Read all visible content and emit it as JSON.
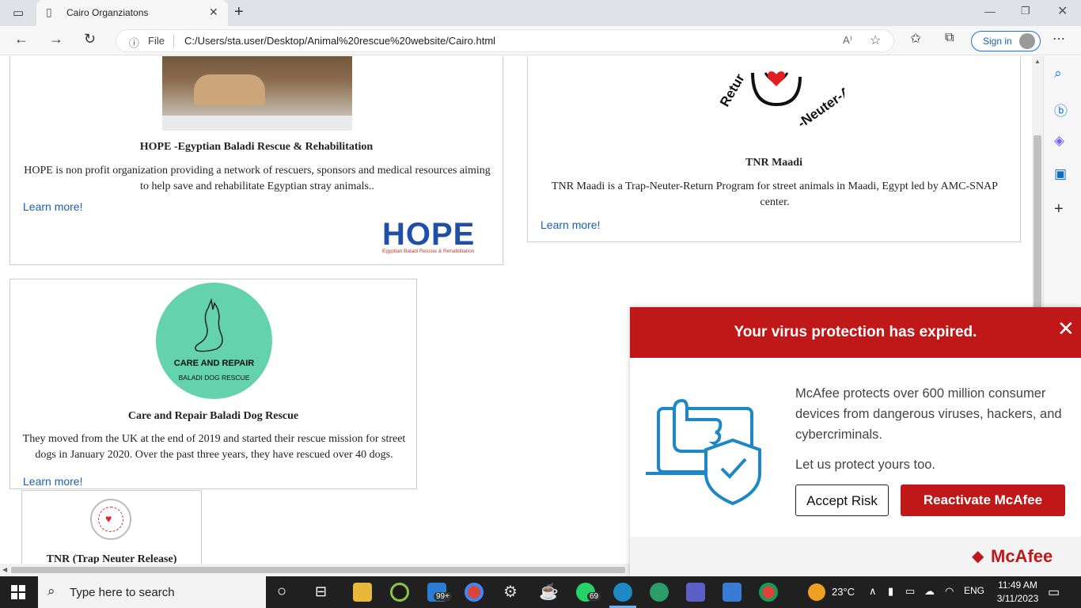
{
  "browser": {
    "tab_title": "Cairo Organziatons",
    "address_label": "File",
    "url": "C:/Users/sta.user/Desktop/Animal%20rescue%20website/Cairo.html",
    "signin_label": "Sign in",
    "read_aloud": "A⁾"
  },
  "cards": [
    {
      "title": "HOPE -Egyptian Baladi Rescue & Rehabilitation",
      "desc_line1": "HOPE is non profit organization providing a network of rescuers, sponsors and medical resources aiming",
      "desc_line2": "to help save and rehabilitate Egyptian stray animals..",
      "link": "Learn more!",
      "logo_text": "HOPE",
      "logo_sub": "Egyptian Baladi Rescue & Rehabilitation"
    },
    {
      "title": "TNR Maadi",
      "desc_line1": "TNR Maadi is a Trap-Neuter-Return Program for street animals in Maadi, Egypt led by AMC-SNAP",
      "desc_line2": "center.",
      "link": "Learn more!",
      "logo_ring_text": "Return - Neuter - Ad"
    },
    {
      "title": "Care and Repair Baladi Dog Rescue",
      "desc_line1": "They moved from the UK at the end of 2019 and started their rescue mission for street",
      "desc_line2": "dogs in January 2020. Over the past three years, they have rescued over 40 dogs.",
      "link": "Learn more!",
      "logo_line1": "CARE AND REPAIR",
      "logo_line2": "BALADI DOG RESCUE"
    },
    {
      "title": "TNR (Trap Neuter Release)"
    }
  ],
  "mcafee": {
    "headline": "Your virus protection has expired.",
    "close": "✕",
    "body": "McAfee protects over 600 million consumer devices from dangerous viruses, hackers, and cybercriminals.",
    "sub": "Let us protect yours too.",
    "accept": "Accept Risk",
    "reactivate": "Reactivate McAfee",
    "brand": "McAfee"
  },
  "taskbar": {
    "search_placeholder": "Type here to search",
    "mail_badge": "99+",
    "whatsapp_badge": "69",
    "temperature": "23°C",
    "language": "ENG",
    "time": "11:49 AM",
    "date": "3/11/2023"
  },
  "colors": {
    "mcafee_red": "#c01818",
    "link_blue": "#1a5fb4",
    "care_green": "#63d2ad"
  }
}
